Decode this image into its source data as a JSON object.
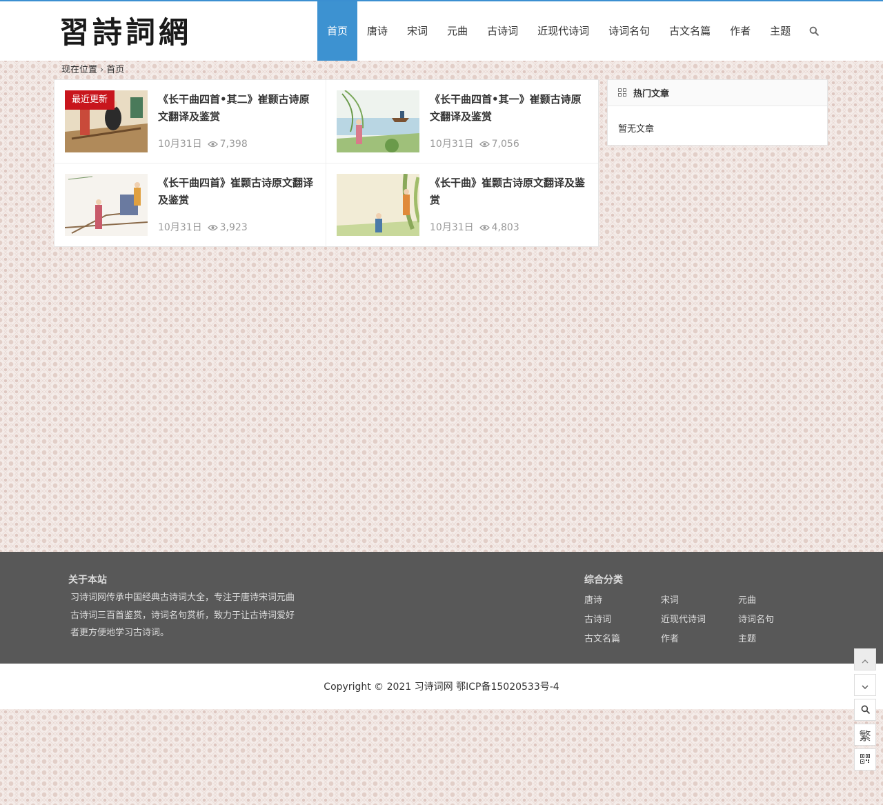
{
  "site": {
    "logo_text": "習詩詞網"
  },
  "nav": {
    "items": [
      "首页",
      "唐诗",
      "宋词",
      "元曲",
      "古诗词",
      "近现代诗词",
      "诗词名句",
      "古文名篇",
      "作者",
      "主题"
    ],
    "active_index": 0,
    "search_icon": "search-icon"
  },
  "breadcrumb": {
    "label": "现在位置",
    "separator": "›",
    "current": "首页"
  },
  "posts": [
    {
      "title": "《长干曲四首•其二》崔颢古诗原文翻译及鉴赏",
      "date": "10月31日",
      "views": "7,398",
      "badge": "最近更新"
    },
    {
      "title": "《长干曲四首•其一》崔颢古诗原文翻译及鉴赏",
      "date": "10月31日",
      "views": "7,056"
    },
    {
      "title": "《长干曲四首》崔颢古诗原文翻译及鉴赏",
      "date": "10月31日",
      "views": "3,923"
    },
    {
      "title": "《长干曲》崔颢古诗原文翻译及鉴赏",
      "date": "10月31日",
      "views": "4,803"
    }
  ],
  "sidebar": {
    "title": "热门文章",
    "empty_text": "暂无文章",
    "icon": "grid-icon"
  },
  "footer": {
    "about_title": "关于本站",
    "about_text": "习诗词网传承中国经典古诗词大全，专注于唐诗宋词元曲古诗词三百首鉴赏，诗词名句赏析，致力于让古诗词爱好者更方便地学习古诗词。",
    "categories_title": "综合分类",
    "categories": [
      "唐诗",
      "宋词",
      "元曲",
      "古诗词",
      "近现代诗词",
      "诗词名句",
      "古文名篇",
      "作者",
      "主题"
    ],
    "copyright": "Copyright © 2021 习诗词网 鄂ICP备15020533号-4"
  },
  "tools": {
    "traditional_label": "繁"
  },
  "colors": {
    "accent": "#3d92d1",
    "badge": "#c8161d",
    "footer_bg": "#585858"
  }
}
